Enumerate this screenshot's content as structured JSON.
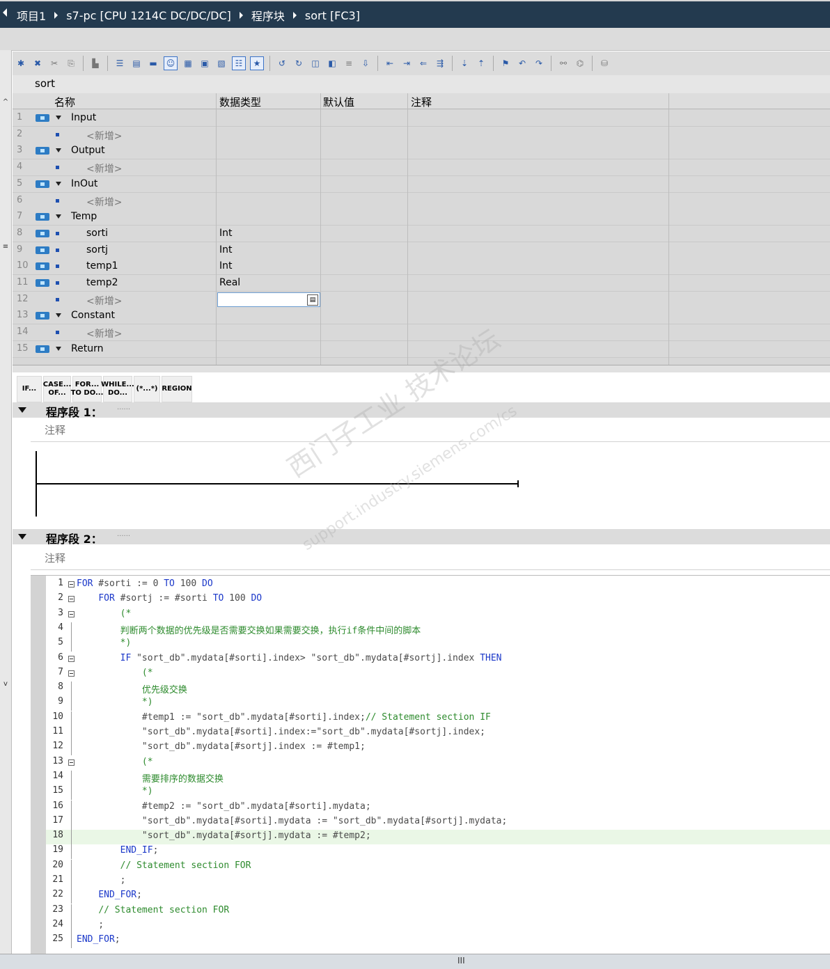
{
  "breadcrumb": [
    "项目1",
    "s7-pc [CPU 1214C DC/DC/DC]",
    "程序块",
    "sort [FC3]"
  ],
  "block_name": "sort",
  "table": {
    "headers": {
      "name": "名称",
      "datatype": "数据类型",
      "default": "默认值",
      "comment": "注释"
    },
    "rows": [
      {
        "num": "1",
        "name": "Input",
        "type": ""
      },
      {
        "num": "2",
        "name": "<新增>",
        "type": ""
      },
      {
        "num": "3",
        "name": "Output",
        "type": ""
      },
      {
        "num": "4",
        "name": "<新增>",
        "type": ""
      },
      {
        "num": "5",
        "name": "InOut",
        "type": ""
      },
      {
        "num": "6",
        "name": "<新增>",
        "type": ""
      },
      {
        "num": "7",
        "name": "Temp",
        "type": ""
      },
      {
        "num": "8",
        "name": "sorti",
        "type": "Int"
      },
      {
        "num": "9",
        "name": "sortj",
        "type": "Int"
      },
      {
        "num": "10",
        "name": "temp1",
        "type": "Int"
      },
      {
        "num": "11",
        "name": "temp2",
        "type": "Real"
      },
      {
        "num": "12",
        "name": "<新增>",
        "type": ""
      },
      {
        "num": "13",
        "name": "Constant",
        "type": ""
      },
      {
        "num": "14",
        "name": "<新增>",
        "type": ""
      },
      {
        "num": "15",
        "name": "Return",
        "type": ""
      }
    ]
  },
  "instructions": [
    "IF...",
    "CASE...\nOF...",
    "FOR...\nTO DO...",
    "WHILE...\nDO...",
    "(*...*)",
    "REGION"
  ],
  "network1": {
    "title": "程序段 1：",
    "dots": "......",
    "comment": "注释"
  },
  "network2": {
    "title": "程序段 2：",
    "dots": "......",
    "comment": "注释"
  },
  "code": [
    "FOR #sorti := 0 TO 100 DO",
    "    FOR #sortj := #sorti TO 100 DO",
    "        (*",
    "        判断两个数据的优先级是否需要交换如果需要交换，执行if条件中间的脚本",
    "        *)",
    "        IF \"sort_db\".mydata[#sorti].index> \"sort_db\".mydata[#sortj].index THEN",
    "            (*",
    "            优先级交换",
    "            *)",
    "            #temp1 := \"sort_db\".mydata[#sorti].index;// Statement section IF",
    "            \"sort_db\".mydata[#sorti].index:=\"sort_db\".mydata[#sortj].index;",
    "            \"sort_db\".mydata[#sortj].index := #temp1;",
    "            (*",
    "            需要排序的数据交换",
    "            *)",
    "            #temp2 := \"sort_db\".mydata[#sorti].mydata;",
    "            \"sort_db\".mydata[#sorti].mydata := \"sort_db\".mydata[#sortj].mydata;",
    "            \"sort_db\".mydata[#sortj].mydata := #temp2;",
    "        END_IF;",
    "        // Statement section FOR",
    "        ;",
    "    END_FOR;",
    "    // Statement section FOR",
    "    ;",
    "END_FOR;"
  ],
  "watermark": {
    "line1": "西门子工业 技术论坛",
    "line2": "support.industry.siemens.com/cs"
  },
  "status": "III"
}
